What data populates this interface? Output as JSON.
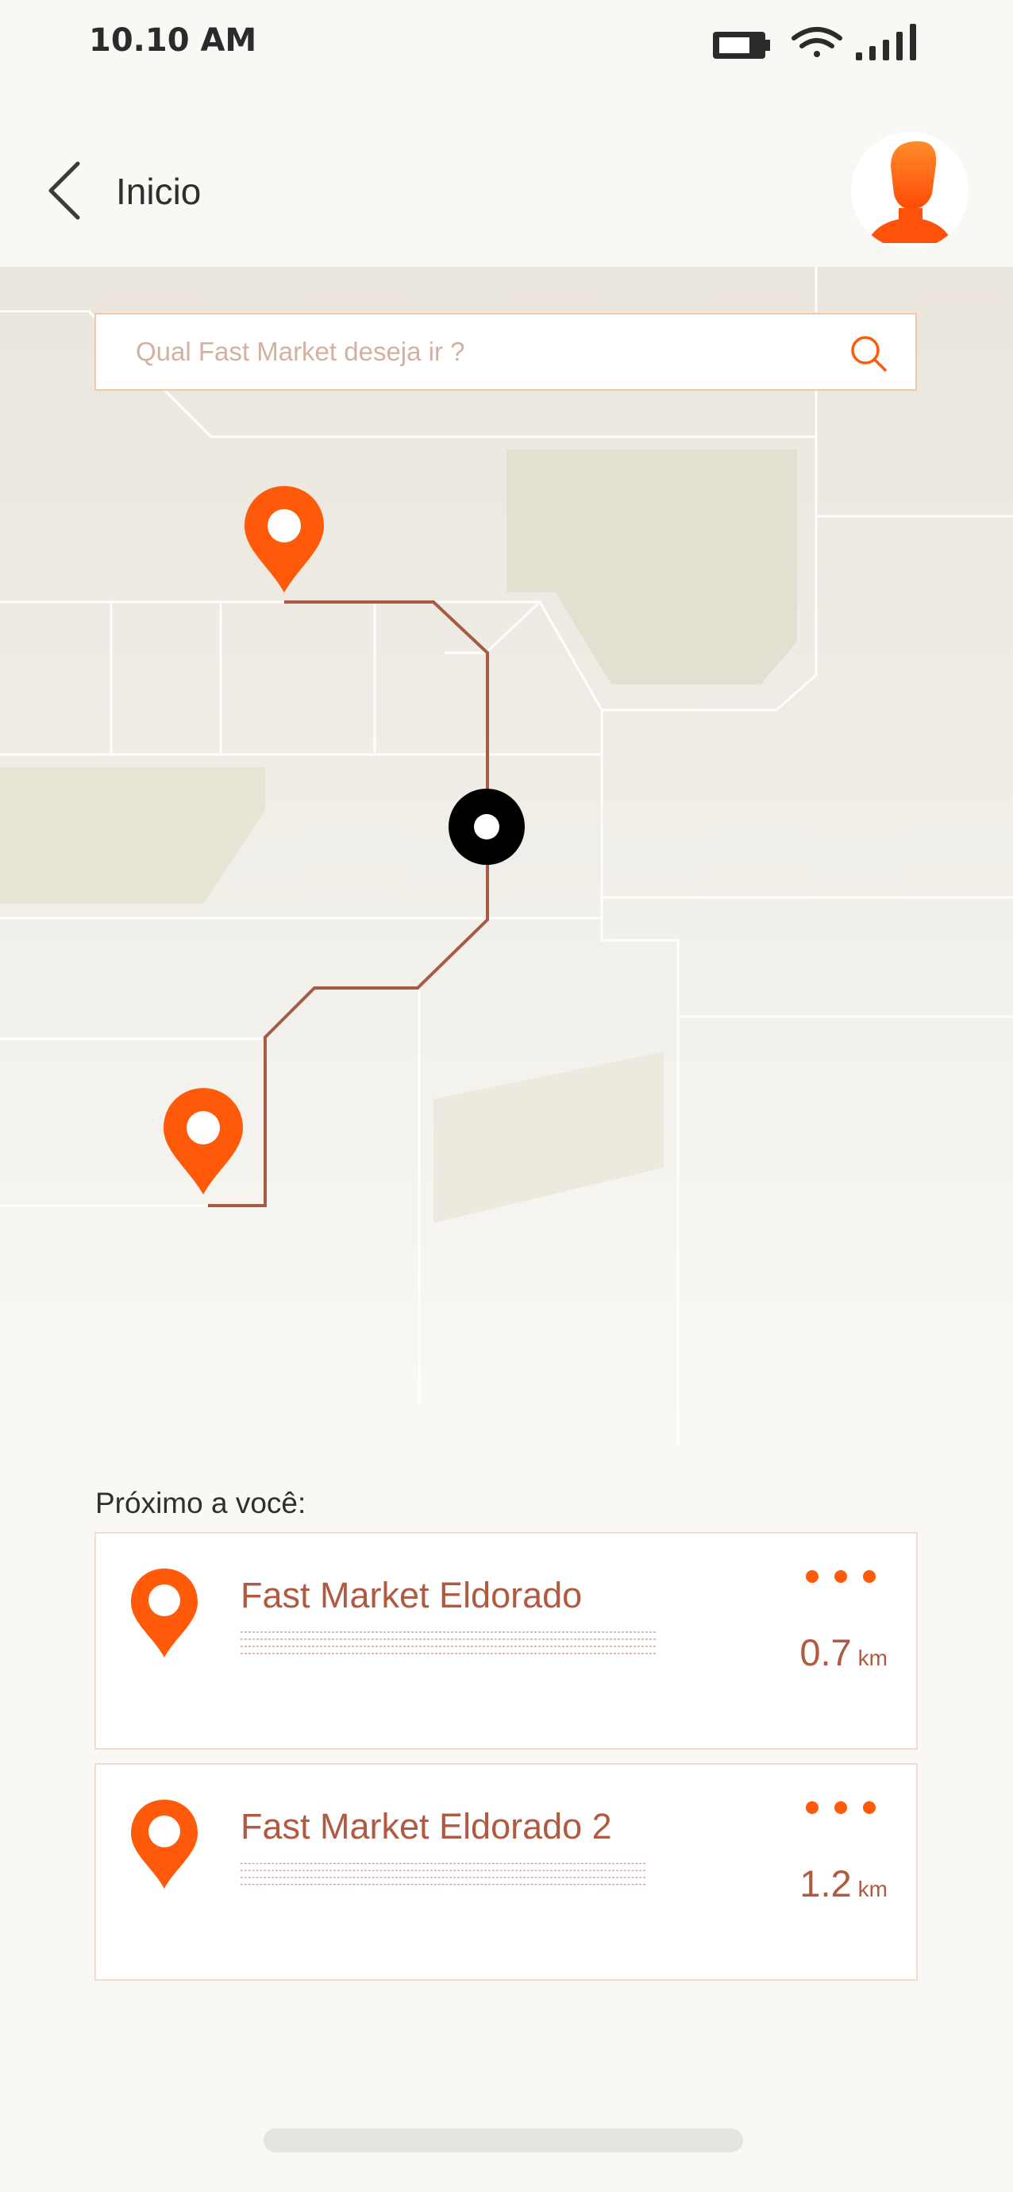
{
  "status_bar": {
    "time": "10.10 AM"
  },
  "header": {
    "title": "Inicio"
  },
  "search": {
    "placeholder": "Qual Fast Market deseja ir ?"
  },
  "nearby": {
    "label": "Próximo a você:",
    "items": [
      {
        "name": "Fast Market Eldorado",
        "distance": "0.7",
        "unit": "km"
      },
      {
        "name": "Fast Market Eldorado 2",
        "distance": "1.2",
        "unit": "km"
      }
    ]
  },
  "colors": {
    "accent": "#ff5a0a",
    "route": "#a85a44",
    "text_brand": "#b05a42"
  }
}
